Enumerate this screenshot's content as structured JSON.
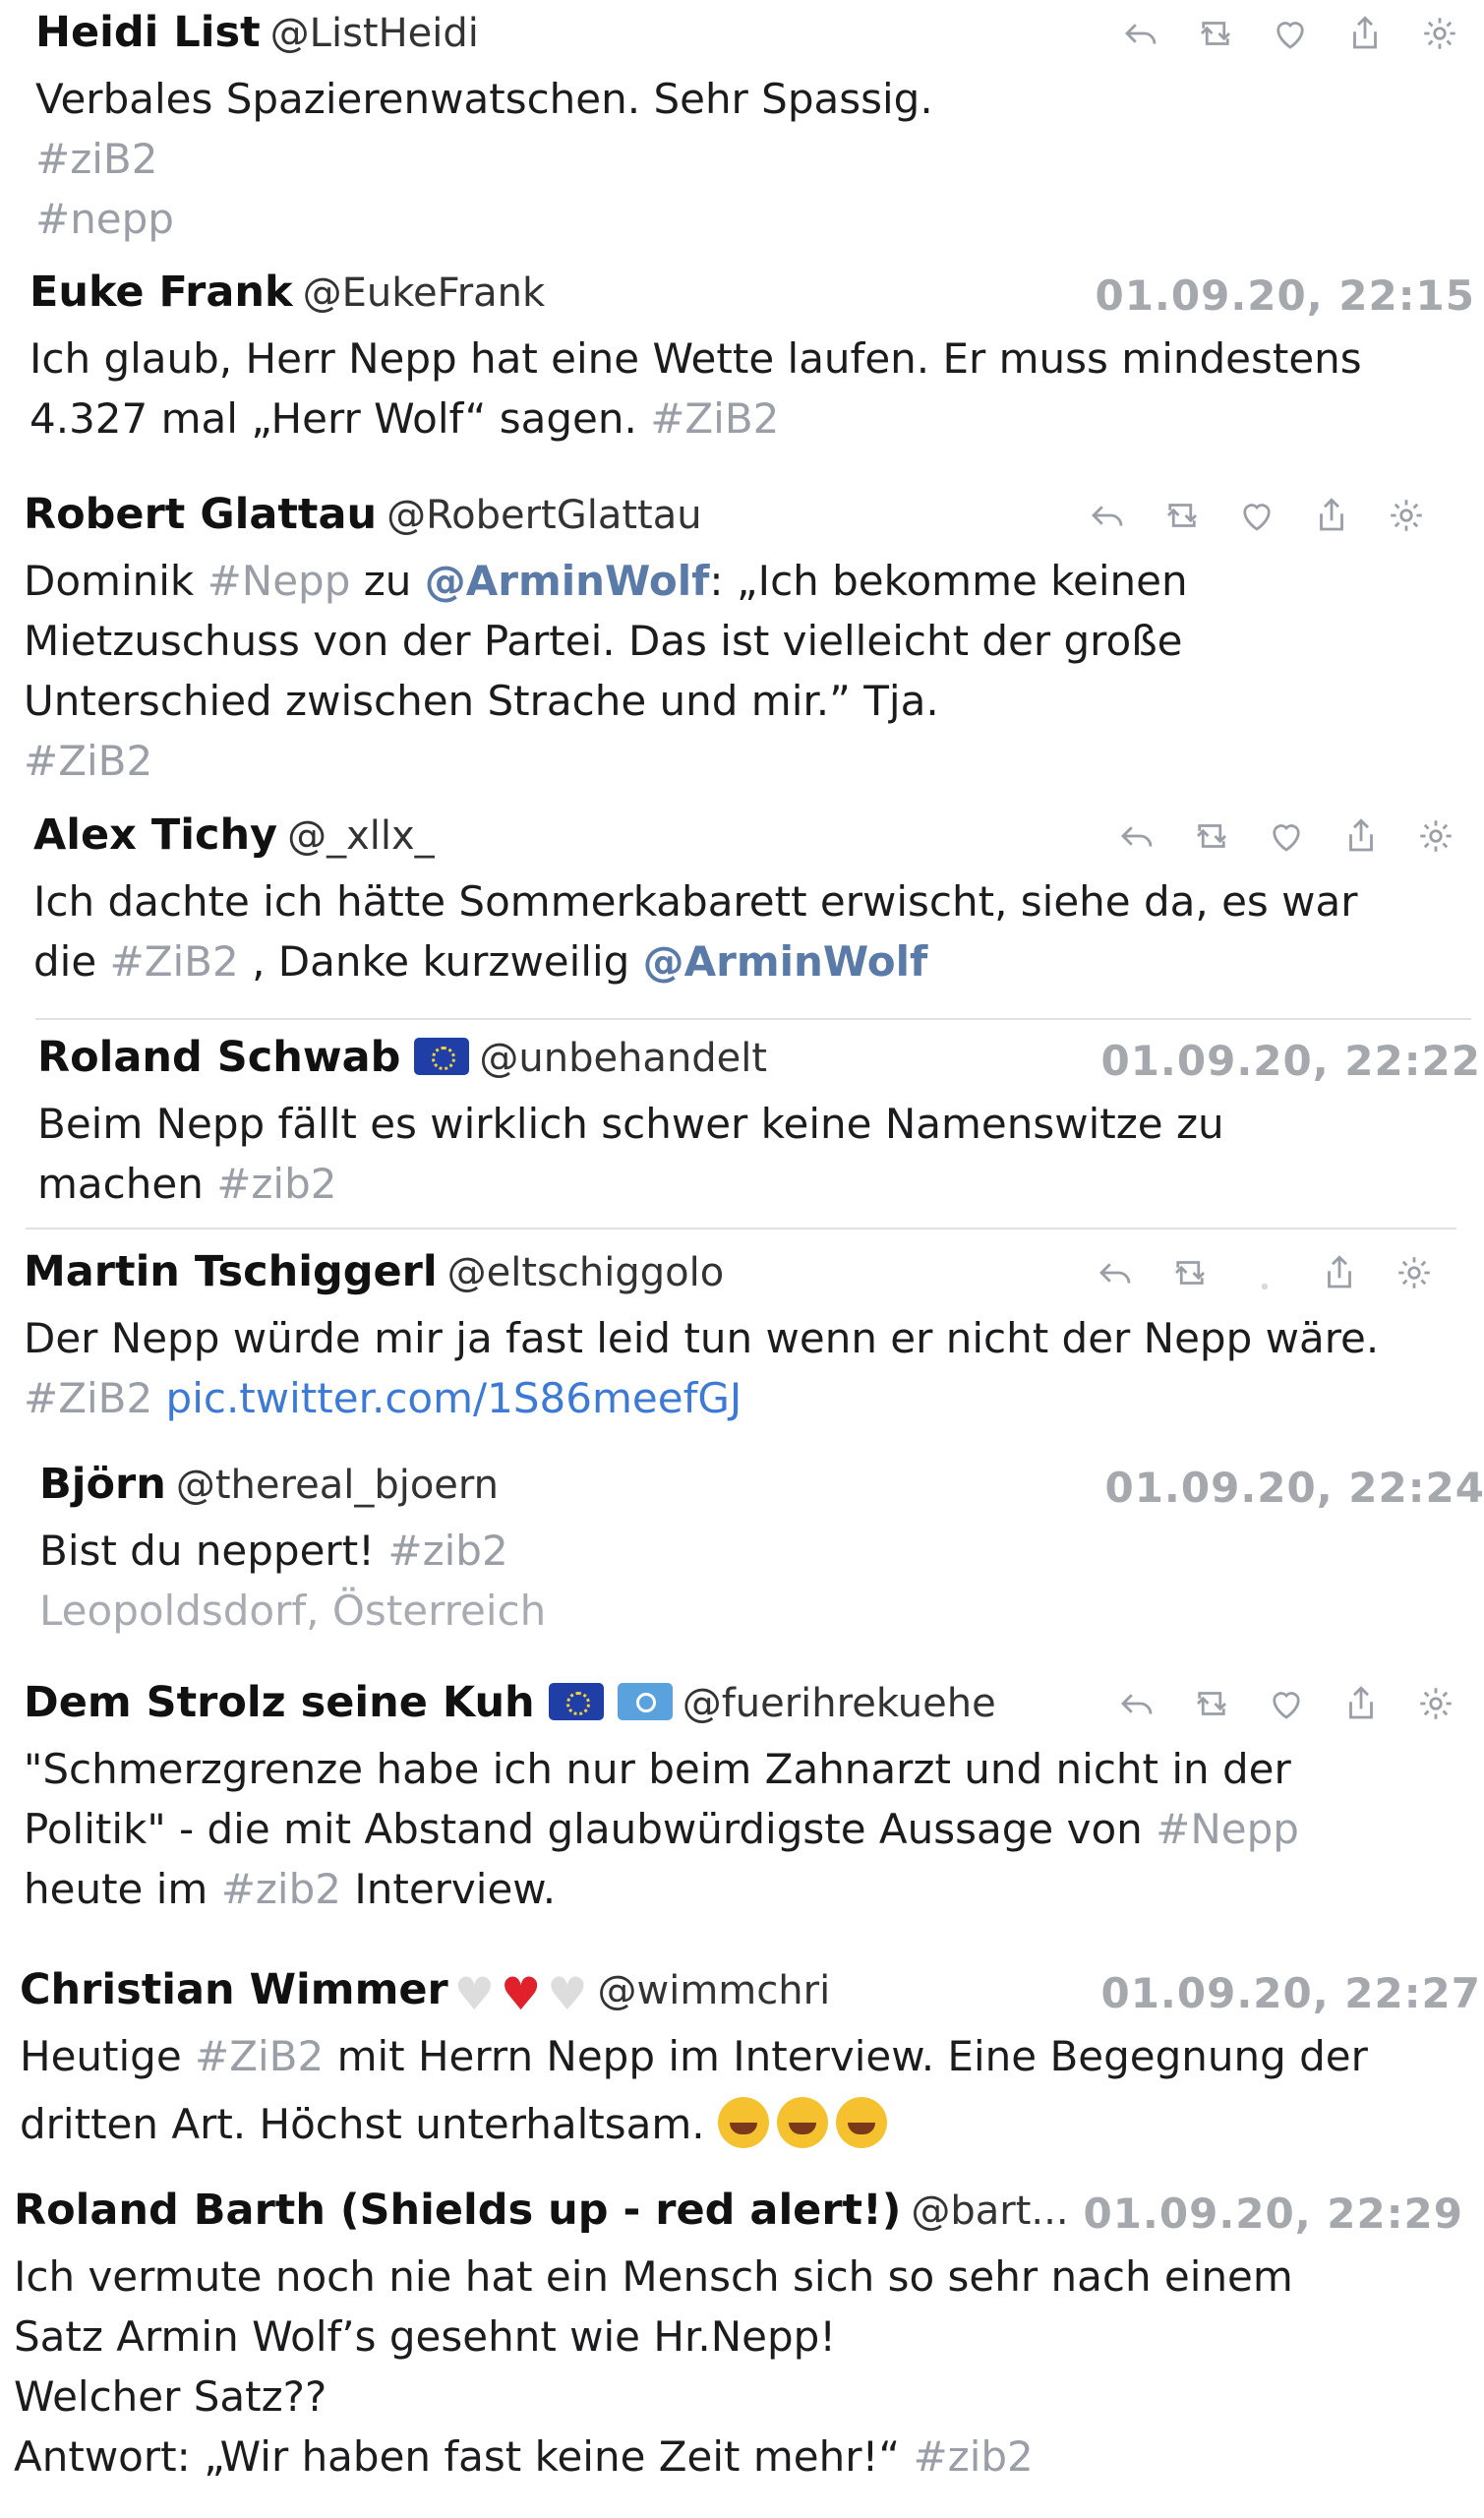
{
  "tweets": [
    {
      "name": "Heidi List",
      "handle": "@ListHeidi",
      "time": "",
      "lines": [
        "Verbales Spazierenwatschen. Sehr Spassig.",
        "#ziB2",
        "#nepp"
      ]
    },
    {
      "name": "Euke Frank",
      "handle": "@EukeFrank",
      "time": "01.09.20, 22:15",
      "lines": [
        "Ich glaub, Herr Nepp hat eine Wette laufen. Er muss mindestens",
        "4.327 mal „Herr Wolf“ sagen.",
        "#ZiB2"
      ]
    },
    {
      "name": "Robert Glattau",
      "handle": "@RobertGlattau",
      "time": "",
      "lines": [
        "Dominik",
        "#Nepp",
        "zu",
        "@ArminWolf",
        "„Ich bekomme keinen",
        "Mietzuschuss von der Partei. Das ist vielleicht der große",
        "Unterschied zwischen Strache und mir.” Tja.",
        "#ZiB2"
      ]
    },
    {
      "name": "Alex Tichy",
      "handle": "@_xllx_",
      "time": "",
      "lines": [
        "Ich dachte ich hätte Sommerkabarett erwischt, siehe da, es war",
        "die",
        "#ZiB2",
        ", Danke kurzweilig",
        "@ArminWolf"
      ]
    },
    {
      "name": "Roland Schwab",
      "handle": "@unbehandelt",
      "time": "01.09.20, 22:22",
      "lines": [
        "Beim Nepp fällt es wirklich schwer keine Namenswitze zu",
        "machen",
        "#zib2"
      ]
    },
    {
      "name": "Martin Tschiggerl",
      "handle": "@eltschiggolo",
      "time": "",
      "lines": [
        "Der Nepp würde mir ja fast leid tun wenn er nicht der Nepp wäre.",
        "#ZiB2",
        "pic.twitter.com/1S86meefGJ"
      ]
    },
    {
      "name": "Björn",
      "handle": "@thereal_bjoern",
      "time": "01.09.20, 22:24",
      "lines": [
        "Bist du neppert!",
        "#zib2",
        "Leopoldsdorf, Österreich"
      ]
    },
    {
      "name": "Dem Strolz seine Kuh",
      "handle": "@fuerihrekuehe",
      "time": "",
      "lines": [
        "\"Schmerzgrenze habe ich nur beim Zahnarzt und nicht in der",
        "Politik\" - die mit Abstand glaubwürdigste  Aussage von",
        "#Nepp",
        "heute im",
        "#zib2",
        "Interview."
      ]
    },
    {
      "name": "Christian Wimmer",
      "handle": "@wimmchri",
      "time": "01.09.20, 22:27",
      "lines": [
        "Heutige",
        "#ZiB2",
        "mit Herrn Nepp im Interview. Eine Begegnung der",
        "dritten Art. Höchst unterhaltsam."
      ]
    },
    {
      "name": "Roland Barth (Shields up - red alert!)",
      "handle": "@bart...",
      "time": "01.09.20, 22:29",
      "lines": [
        "Ich vermute noch nie hat ein Mensch sich so sehr nach einem",
        "Satz Armin Wolf’s gesehnt wie Hr.Nepp!",
        "Welcher Satz??",
        "Antwort: „Wir haben fast keine Zeit mehr!“",
        "#zib2"
      ]
    }
  ],
  "icons": {
    "reply": "reply-icon",
    "retweet": "retweet-icon",
    "like": "heart-icon",
    "share": "share-icon",
    "more": "gear-icon"
  }
}
